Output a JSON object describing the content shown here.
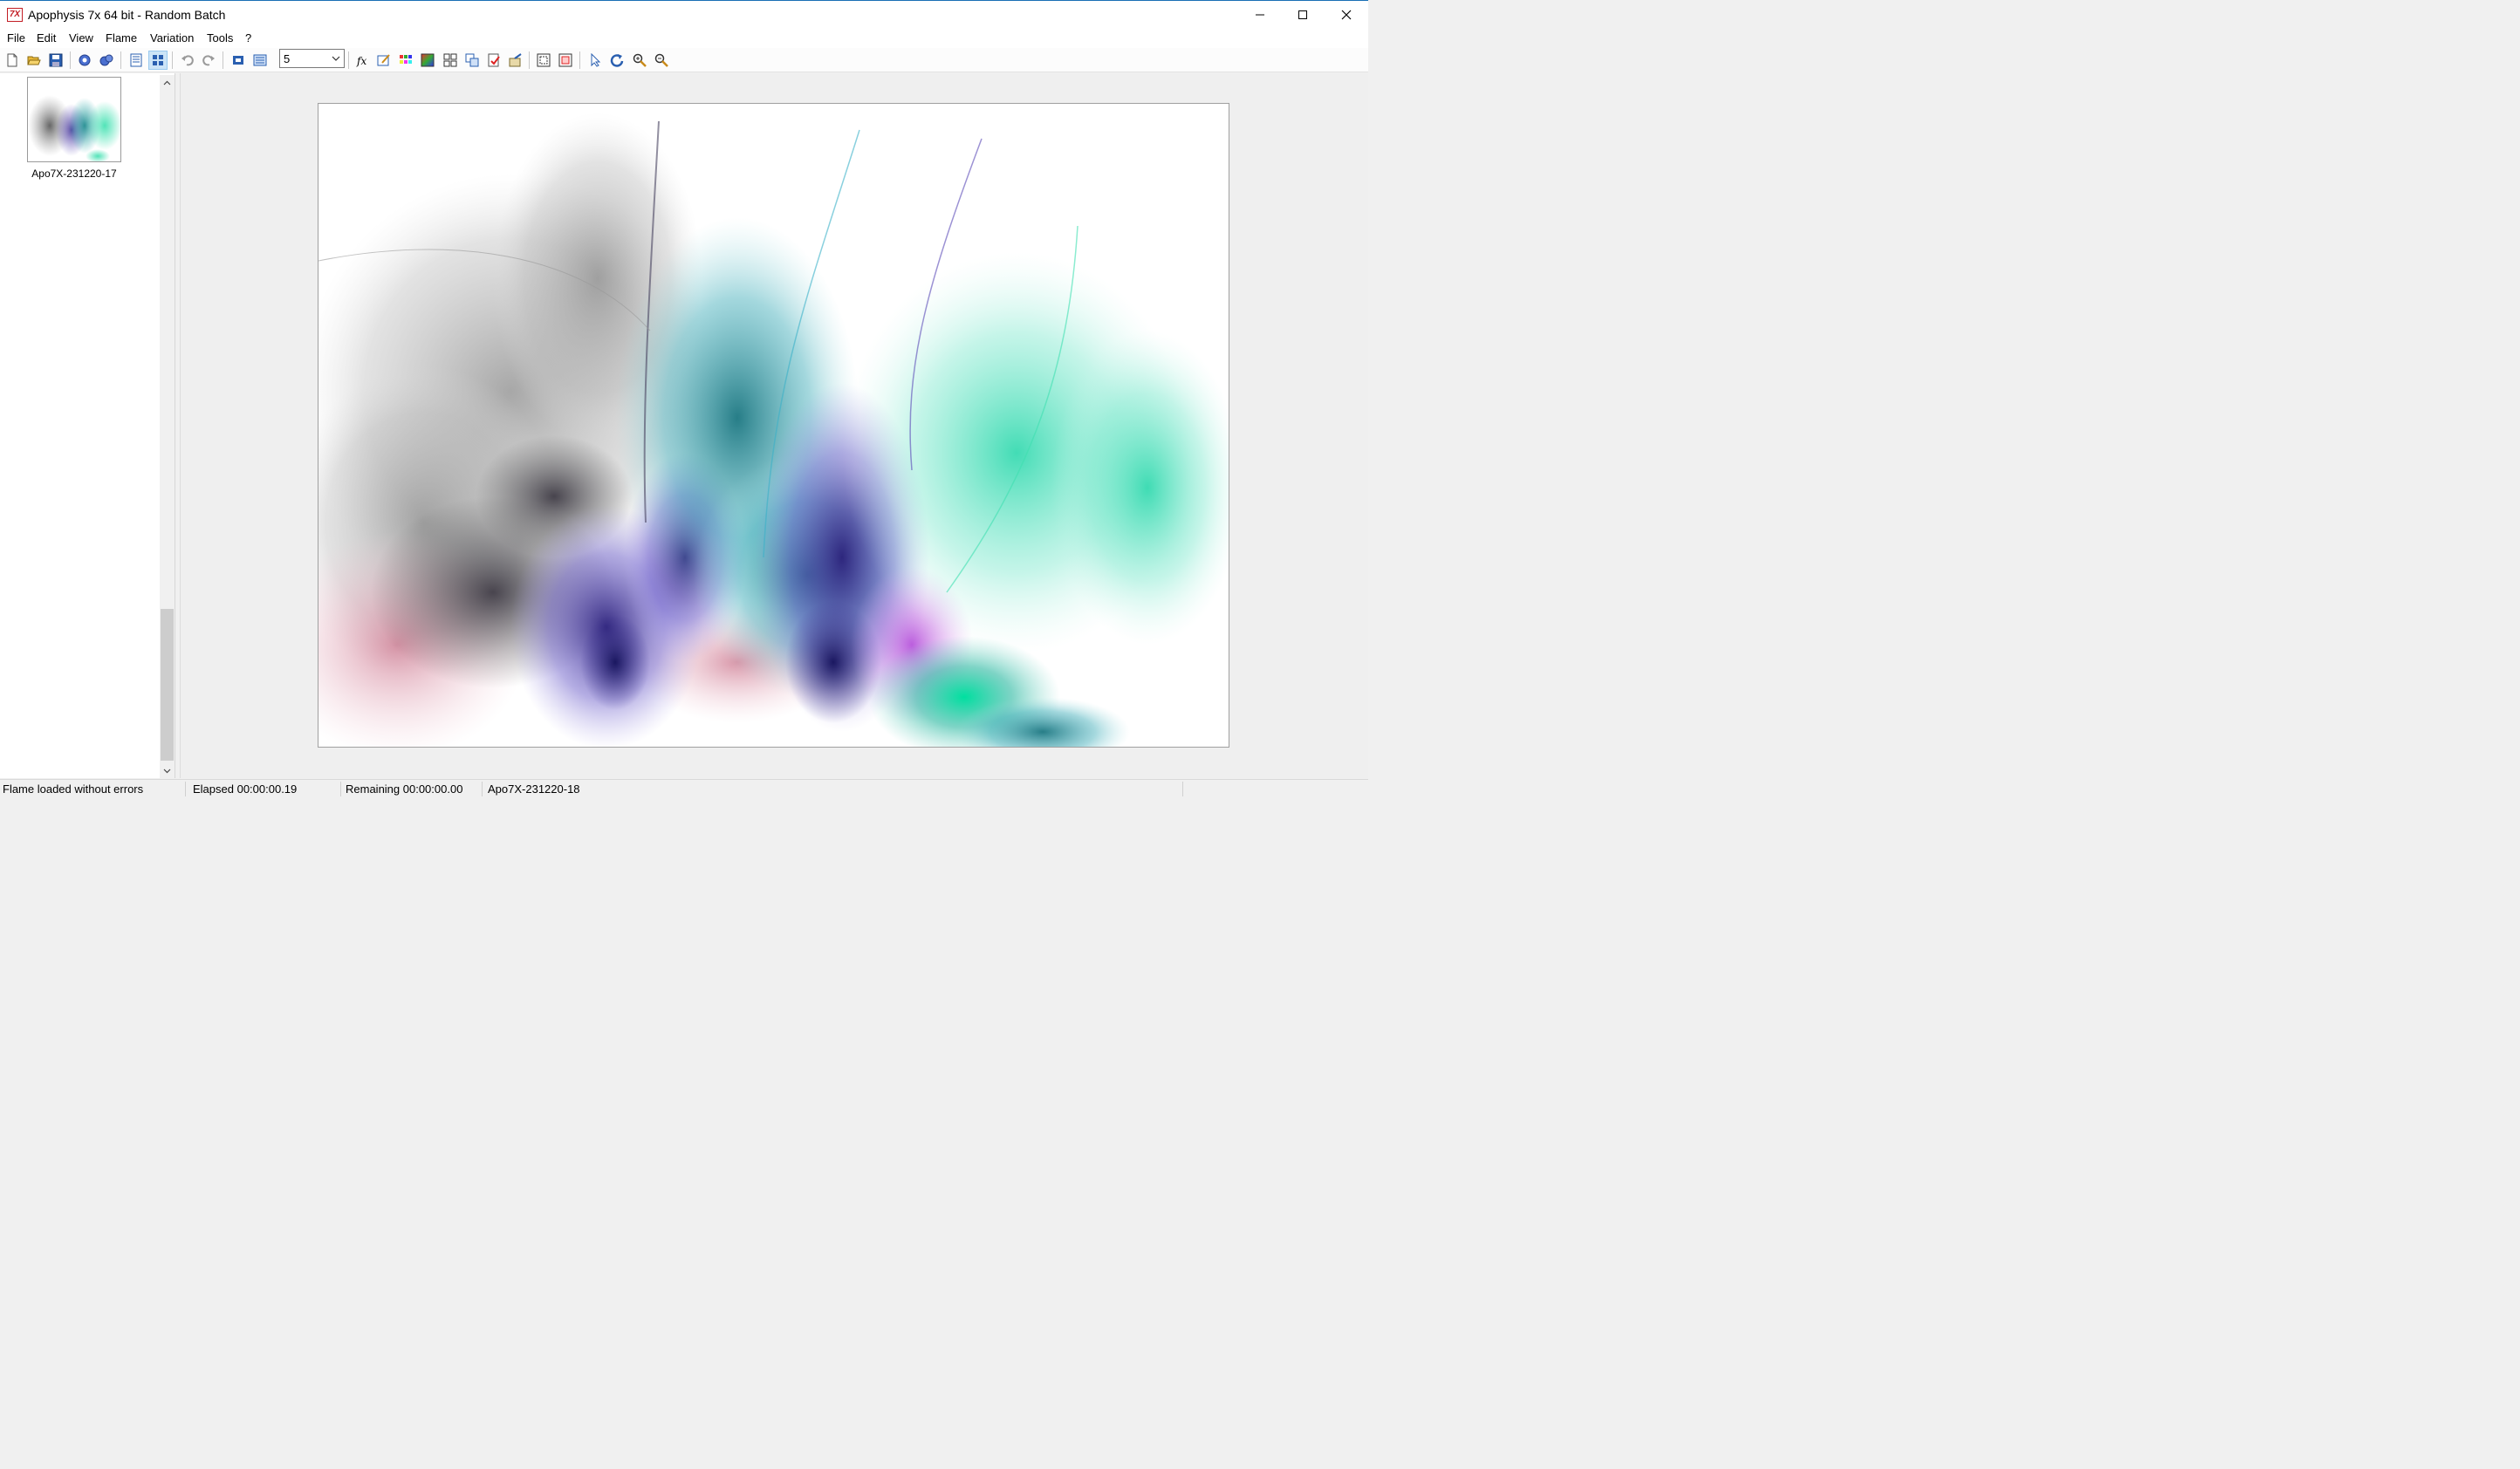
{
  "window": {
    "title": "Apophysis 7x 64 bit - Random Batch",
    "app_icon_text": "7X",
    "accent": "#c21d24"
  },
  "menu": [
    "File",
    "Edit",
    "View",
    "Flame",
    "Variation",
    "Tools",
    "?"
  ],
  "toolbar": {
    "buttons": [
      "new-icon",
      "open-icon",
      "save-icon",
      "render-icon",
      "render-all-icon",
      "list-view-icon",
      "icon-view-icon",
      "undo-icon",
      "redo-icon",
      "fullscreen-icon",
      "editor-icon",
      "fx-icon",
      "adjust-icon",
      "gradient-icon",
      "color-palette-icon",
      "mutate-icon",
      "transform-icon",
      "export-icon",
      "options-icon",
      "script-icon",
      "show-transparency-icon",
      "film-icon",
      "pointer-icon",
      "rotate-icon",
      "zoom-in-icon",
      "zoom-out-icon"
    ],
    "batch_select": {
      "value": "5"
    }
  },
  "flame_list": {
    "items": [
      {
        "label": "Apo7X-231220-17",
        "selected": true
      }
    ]
  },
  "status": {
    "message": "Flame loaded without errors",
    "elapsed": "Elapsed 00:00:00.19",
    "remaining": "Remaining 00:00:00.00",
    "current_flame": "Apo7X-231220-18"
  }
}
